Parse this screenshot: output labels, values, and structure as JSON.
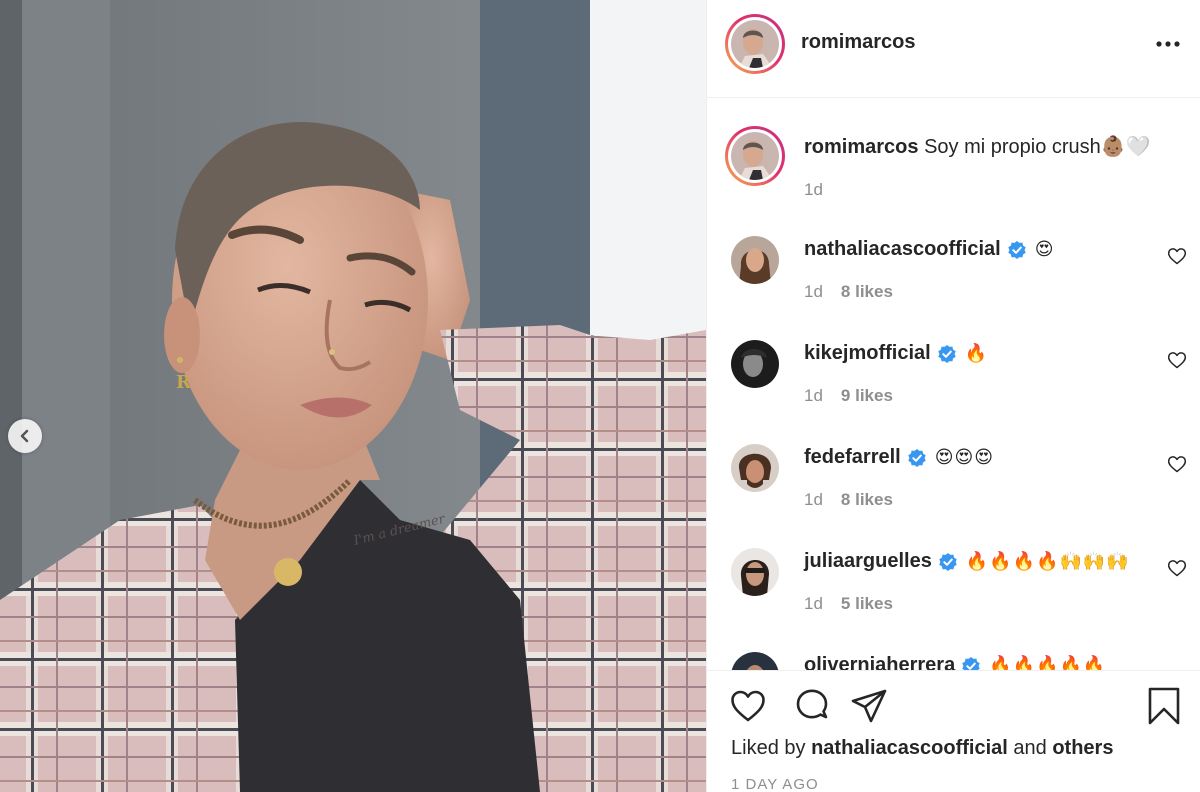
{
  "post": {
    "author": "romimarcos",
    "caption_text": "Soy mi propio crush👶🏽🤍",
    "caption_time": "1d"
  },
  "comments": [
    {
      "user": "nathaliacascoofficial",
      "text": "😍",
      "time": "1d",
      "likes": "8 likes",
      "verified": true
    },
    {
      "user": "kikejmofficial",
      "text": "🔥",
      "time": "1d",
      "likes": "9 likes",
      "verified": true
    },
    {
      "user": "fedefarrell",
      "text": "😍😍😍",
      "time": "1d",
      "likes": "8 likes",
      "verified": true
    },
    {
      "user": "juliaarguelles",
      "text": "🔥🔥🔥🔥🙌🙌🙌",
      "time": "1d",
      "likes": "5 likes",
      "verified": true
    },
    {
      "user": "oliverniaherrera",
      "text": "🔥🔥🔥🔥🔥",
      "time": "",
      "likes": "",
      "verified": true
    }
  ],
  "footer": {
    "liked_by_prefix": "Liked by",
    "liked_by_user": "nathaliacascoofficial",
    "liked_by_and": "and",
    "liked_by_others": "others",
    "date": "1 DAY AGO"
  },
  "icons": {
    "like": "heart-icon",
    "comment": "comment-icon",
    "share": "share-icon",
    "save": "bookmark-icon",
    "more": "more-icon",
    "prev": "chevron-left-icon",
    "verified": "verified-badge-icon"
  },
  "colors": {
    "verified_blue": "#3897f0",
    "muted_text": "#8e8e8e",
    "story_ring_start": "#f9b24e",
    "story_ring_end": "#c13584"
  }
}
